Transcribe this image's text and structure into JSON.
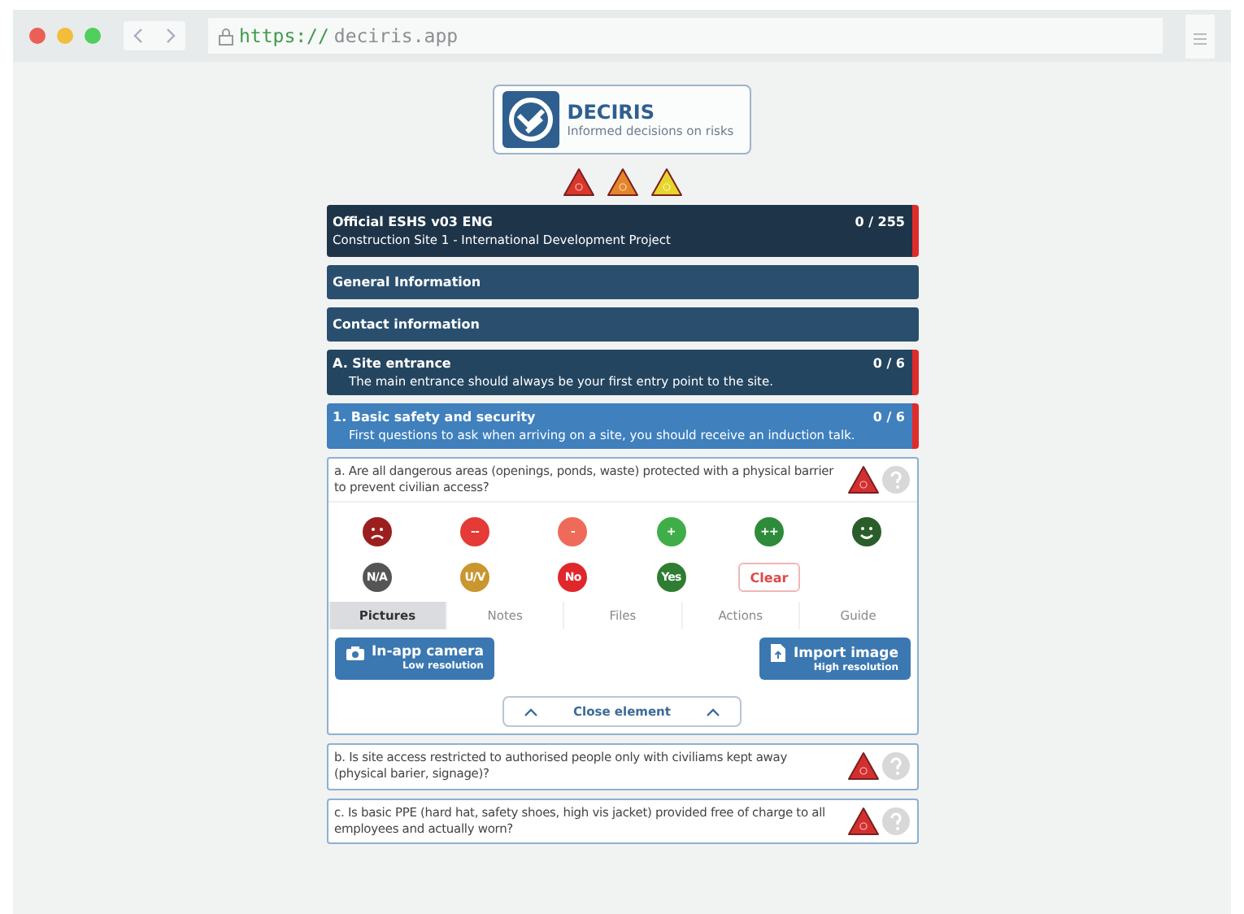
{
  "browser": {
    "url_scheme": "https://",
    "url_host": "deciris.app"
  },
  "logo": {
    "title": "DECIRIS",
    "tagline": "Informed decisions on risks"
  },
  "risk_levels": [
    {
      "color": "#d9372b"
    },
    {
      "color": "#e3862a"
    },
    {
      "color": "#e6d62c"
    }
  ],
  "sections": [
    {
      "kind": "survey",
      "title": "Official ESHS v03 ENG",
      "subtitle": "Construction Site 1 - International Development Project",
      "count": "0 / 255",
      "flagged": true,
      "expanded": false
    },
    {
      "kind": "plain",
      "title": "General Information",
      "flagged": false,
      "expanded": false
    },
    {
      "kind": "plain",
      "title": "Contact information",
      "flagged": false,
      "expanded": false
    },
    {
      "kind": "section",
      "title": "A. Site entrance",
      "subtitle": "The main entrance should always be your first entry point to the site.",
      "count": "0 / 6",
      "flagged": true,
      "expanded": false
    },
    {
      "kind": "section",
      "title": "1. Basic safety and security",
      "subtitle": "First questions to ask when arriving on a site, you should receive an induction talk.",
      "count": "0 / 6",
      "flagged": true,
      "expanded": true
    }
  ],
  "questions": [
    {
      "text": "a. Are all dangerous areas (openings, ponds, waste) protected with a physical barrier to prevent civilian access?",
      "expanded": true,
      "ratings": [
        {
          "kind": "sad",
          "color": "#9c1f1f"
        },
        {
          "kind": "text",
          "label": "--",
          "color": "#e53a35"
        },
        {
          "kind": "text",
          "label": "-",
          "color": "#f06a5a"
        },
        {
          "kind": "text",
          "label": "+",
          "color": "#3fae48"
        },
        {
          "kind": "text",
          "label": "++",
          "color": "#2e8b3a"
        },
        {
          "kind": "happy",
          "color": "#2a5d2a"
        },
        {
          "kind": "text",
          "label": "N/A",
          "color": "#555555"
        },
        {
          "kind": "text",
          "label": "U/V",
          "color": "#c9962f"
        },
        {
          "kind": "text",
          "label": "No",
          "color": "#e0272b"
        },
        {
          "kind": "text",
          "label": "Yes",
          "color": "#2e7d32"
        }
      ],
      "clear": "Clear",
      "tabs": [
        {
          "label": "Pictures",
          "selected": true
        },
        {
          "label": "Notes",
          "selected": false
        },
        {
          "label": "Files",
          "selected": false
        },
        {
          "label": "Actions",
          "selected": false
        },
        {
          "label": "Guide",
          "selected": false
        }
      ],
      "actions": [
        {
          "kind": "camera",
          "label": "In-app camera",
          "note": "Low resolution"
        },
        {
          "kind": "import",
          "label": "Import image",
          "note": "High resolution"
        }
      ],
      "close": "Close element"
    },
    {
      "text": "b. Is site access restricted to authorised people only with civiliams kept away (physical barier, signage)?",
      "expanded": false
    },
    {
      "text": "c. Is basic PPE (hard hat, safety shoes, high vis jacket) provided free of charge to all employees and actually worn?",
      "expanded": false
    }
  ]
}
